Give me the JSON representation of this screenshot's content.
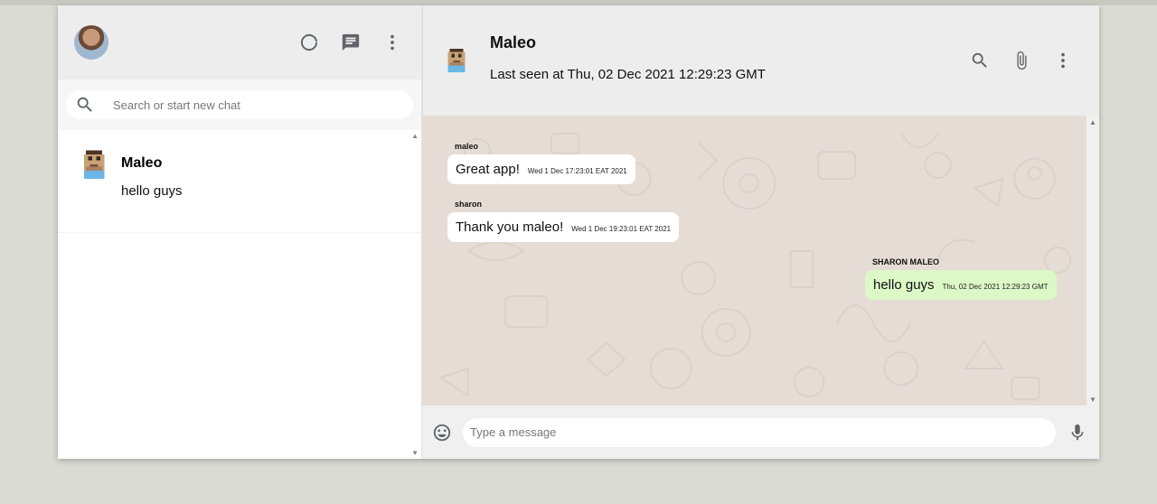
{
  "sidebar": {
    "search_placeholder": "Search or start new chat",
    "chats": [
      {
        "name": "Maleo",
        "last_message": "hello guys"
      }
    ]
  },
  "chat": {
    "contact_name": "Maleo",
    "last_seen": "Last seen at Thu, 02 Dec 2021 12:29:23 GMT",
    "messages": [
      {
        "sender": "maleo",
        "text": "Great app!",
        "time": "Wed 1 Dec 17:23:01 EAT 2021",
        "outgoing": false
      },
      {
        "sender": "sharon",
        "text": "Thank you maleo!",
        "time": "Wed 1 Dec 19:23:01 EAT 2021",
        "outgoing": false
      },
      {
        "sender": "SHARON MALEO",
        "text": "hello guys",
        "time": "Thu, 02 Dec 2021 12:29:23 GMT",
        "outgoing": true
      }
    ],
    "input_placeholder": "Type a message"
  },
  "icons": {
    "status": "status-icon",
    "new_chat": "new-chat-icon",
    "menu": "more-vert-icon",
    "search": "search-icon",
    "attach": "attach-icon",
    "emoji": "emoji-icon",
    "mic": "mic-icon"
  },
  "colors": {
    "header_bg": "#ededed",
    "chat_bg": "#e5ddd5",
    "outgoing_bubble": "#dcf8c6",
    "incoming_bubble": "#ffffff",
    "page_bg": "#dadbd3"
  }
}
